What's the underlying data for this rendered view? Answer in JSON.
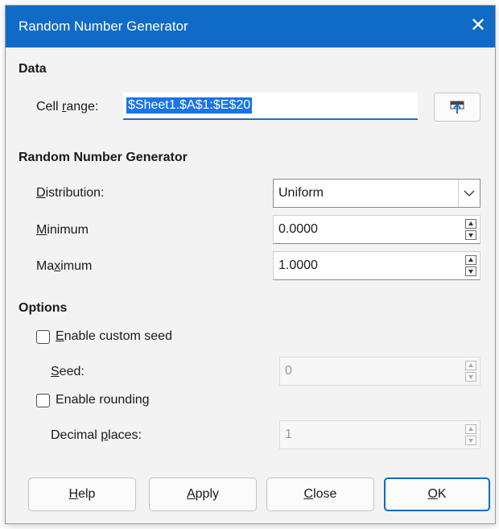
{
  "window": {
    "title": "Random Number Generator"
  },
  "data_section": {
    "heading": "Data",
    "cell_range_label_pre": "Cell ",
    "cell_range_label_key": "r",
    "cell_range_label_post": "ange:",
    "cell_range_value": "$Sheet1.$A$1:$E$20"
  },
  "generator_section": {
    "heading": "Random Number Generator",
    "distribution_label_key": "D",
    "distribution_label_rest": "istribution:",
    "distribution_value": "Uniform",
    "minimum_label_key": "M",
    "minimum_label_rest": "inimum",
    "minimum_value": "0.0000",
    "maximum_label_pre": "Ma",
    "maximum_label_key": "x",
    "maximum_label_rest": "imum",
    "maximum_value": "1.0000"
  },
  "options_section": {
    "heading": "Options",
    "custom_seed_key": "E",
    "custom_seed_rest": "nable custom seed",
    "custom_seed_checked": false,
    "seed_label_key": "S",
    "seed_label_rest": "eed:",
    "seed_value": "0",
    "rounding_label": "Enable rounding",
    "rounding_checked": false,
    "decimal_label_pre": "Decimal ",
    "decimal_label_key": "p",
    "decimal_label_rest": "laces:",
    "decimal_value": "1"
  },
  "buttons": {
    "help_key": "H",
    "help_rest": "elp",
    "apply_key": "A",
    "apply_rest": "pply",
    "close_key": "C",
    "close_rest": "lose",
    "ok_key": "O",
    "ok_rest": "K"
  },
  "icons": {
    "close": "close-icon",
    "shrink": "shrink-dialog-icon",
    "dropdown": "chevron-down-icon",
    "spin_up": "spin-up-icon",
    "spin_down": "spin-down-icon"
  },
  "colors": {
    "titlebar": "#0f6bc7",
    "selection": "#1a73e8",
    "focus_underline": "#1d6fc1"
  }
}
